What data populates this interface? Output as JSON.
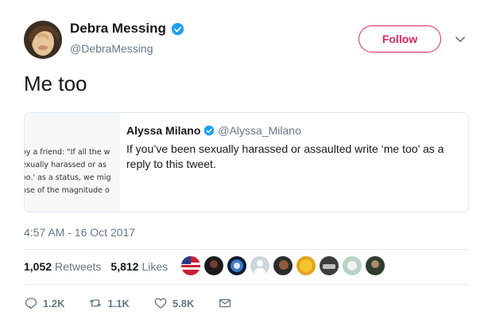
{
  "author": {
    "display_name": "Debra Messing",
    "handle": "@DebraMessing",
    "verified_icon": "verified-badge-icon"
  },
  "follow_label": "Follow",
  "tweet_text": "Me too",
  "quoted": {
    "display_name": "Alyssa Milano",
    "handle": "@Alyssa_Milano",
    "text": "If you’ve been sexually harassed or assaulted write ‘me too’ as a reply to this tweet.",
    "image_lines": [
      "oy a friend: \"If all the w",
      "exually harassed or as",
      "oo.' as a status, we mig",
      "nse of the magnitude o"
    ]
  },
  "timestamp": "4:57 AM - 16 Oct 2017",
  "stats": {
    "retweets_count": "1,052",
    "retweets_label": "Retweets",
    "likes_count": "5,812",
    "likes_label": "Likes"
  },
  "actions": {
    "reply_count": "1.2K",
    "retweet_count": "1.1K",
    "like_count": "5.8K"
  },
  "colors": {
    "accent": "#e0245e",
    "verified": "#1da1f2",
    "muted": "#657786"
  }
}
